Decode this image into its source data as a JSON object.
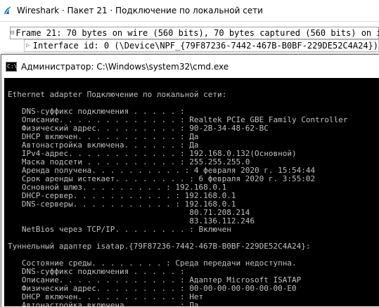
{
  "wireshark": {
    "title": "Wireshark · Пакет 21 · Подключение по локальной сети",
    "logo_icon": "wireshark-fin-icon",
    "logo_color": "#1679c9",
    "packet_details": [
      {
        "toggle": "⊟",
        "text": "Frame 21: 70 bytes on wire (560 bits), 70 bytes captured (560 bits) on int"
      },
      {
        "toggle": "▷",
        "text": "Interface id: 0 (\\Device\\NPF_{79F87236-7442-467B-B0BF-229DE52C4A24})"
      }
    ]
  },
  "cmd": {
    "title": "Администратор: C:\\Windows\\system32\\cmd.exe",
    "icon": "cmd-icon",
    "lines": [
      "",
      "Ethernet adapter Подключение по локальной сети:",
      "",
      "   DNS-суффикс подключения . . . . . :",
      "   Описание. . . . . . . . . . . . . : Realtek PCIe GBE Family Controller",
      "   Физический адрес. . . . . . . . . : 90-2B-34-48-62-BC",
      "   DHCP включен. . . . . . . . . . . : Да",
      "   Автонастройка включена. . . . . . : Да",
      "   IPv4-адрес. . . . . . . . . . . . : 192.168.0.132(Основной)",
      "   Маска подсети . . . . . . . . . . : 255.255.255.0",
      "   Аренда получена. . . . . . . . . . : 4 февраля 2020 г. 15:54:44",
      "   Срок аренды истекает. . . . . . . . : 6 февраля 2020 г. 3:55:02",
      "   Основной шлюз. . . . . . . . . : 192.168.0.1",
      "   DHCP-сервер. . . . . . . . . . . : 192.168.0.1",
      "   DNS-серверы. . . . . . . . . . . : 192.168.0.1",
      "                                       80.71.208.214",
      "                                       83.136.112.246",
      "   NetBios через TCP/IP. . . . . . . . : Включен",
      "",
      "Туннельный адаптер isatap.{79F87236-7442-467B-B0BF-229DE52C4A24}:",
      "",
      "   Состояние среды. . . . . . . . : Среда передачи недоступна.",
      "   DNS-суффикс подключения . . . . . :",
      "   Описание. . . . . . . . . . . . . : Адаптер Microsoft ISATAP",
      "   Физический адрес. . . . . . . . . : 00-00-00-00-00-00-00-E0",
      "   DHCP включен. . . . . . . . . . . : Нет",
      "   Автонастройка включена. . . . . . : Да"
    ]
  }
}
